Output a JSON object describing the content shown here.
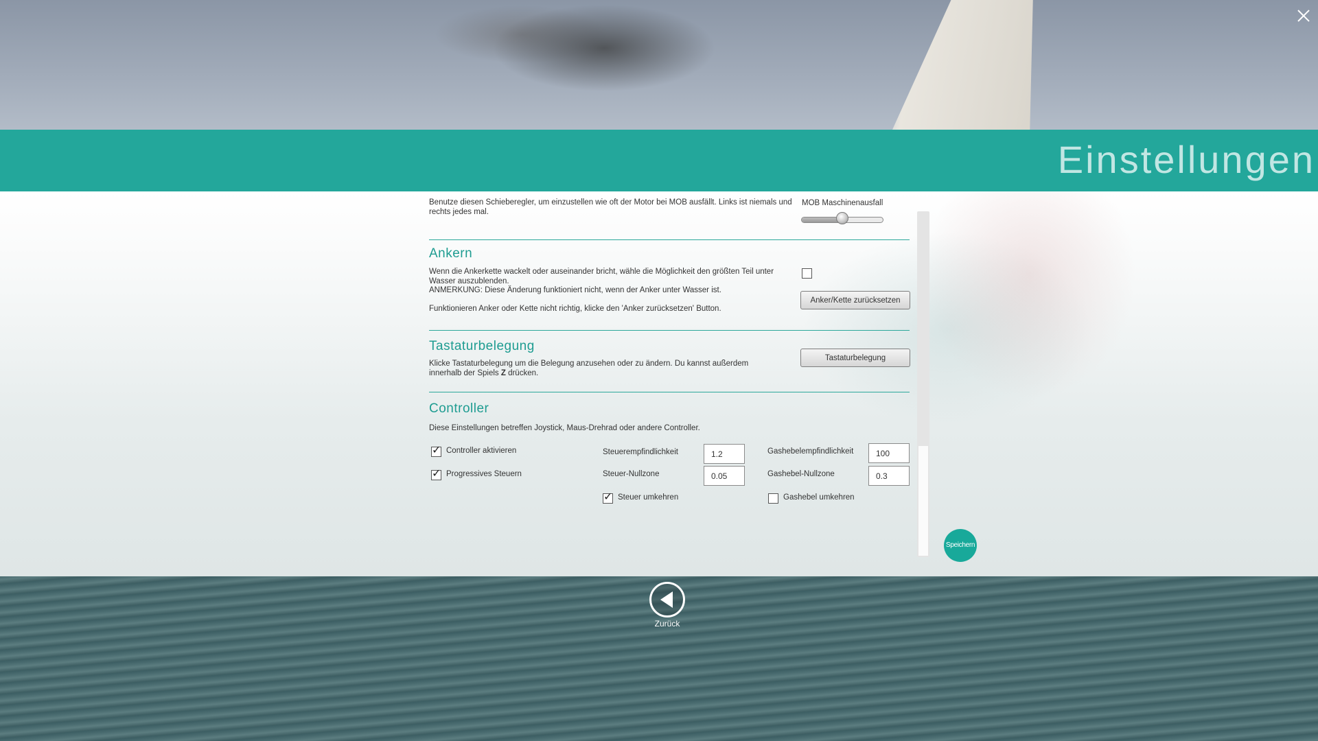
{
  "window": {
    "title": "Einstellungen",
    "close_icon": "close-icon"
  },
  "motor": {
    "description": "Benutze diesen Schieberegler, um einzustellen wie oft der Motor bei MOB ausfällt. Links ist niemals und rechts jedes mal.",
    "slider_label": "MOB Maschinenausfall",
    "slider_value_fraction": 0.5
  },
  "anchor": {
    "title": "Ankern",
    "text_line1": "Wenn die Ankerkette wackelt oder auseinander bricht, wähle die Möglichkeit den größten Teil unter Wasser auszublenden.",
    "text_line2": "ANMERKUNG: Diese Änderung funktioniert nicht, wenn der Anker unter Wasser ist.",
    "text_line3": "Funktionieren Anker oder Kette nicht richtig, klicke den 'Anker zurücksetzen' Button.",
    "hide_checked": false,
    "reset_button": "Anker/Kette zurücksetzen"
  },
  "keyboard": {
    "title": "Tastaturbelegung",
    "text_part1": "Klicke Tastaturbelegung um die Belegung anzusehen oder zu ändern. Du kannst außerdem innerhalb der Spiels ",
    "text_key": "Z",
    "text_part2": " drücken.",
    "button": "Tastaturbelegung"
  },
  "controller": {
    "title": "Controller",
    "description": "Diese Einstellungen betreffen Joystick, Maus-Drehrad oder andere Controller.",
    "enable_label": "Controller aktivieren",
    "enable_checked": true,
    "progressive_label": "Progressives Steuern",
    "progressive_checked": true,
    "steer_sensitivity_label": "Steuerempfindlichkeit",
    "steer_sensitivity_value": "1.2",
    "steer_deadzone_label": "Steuer-Nullzone",
    "steer_deadzone_value": "0.05",
    "steer_invert_label": "Steuer umkehren",
    "steer_invert_checked": true,
    "throttle_sensitivity_label": "Gashebelempfindlichkeit",
    "throttle_sensitivity_value": "100",
    "throttle_deadzone_label": "Gashebel-Nullzone",
    "throttle_deadzone_value": "0.3",
    "throttle_invert_label": "Gashebel umkehren",
    "throttle_invert_checked": false
  },
  "actions": {
    "save": "Speichern",
    "back": "Zurück",
    "back_icon": "back-arrow-icon"
  },
  "colors": {
    "accent": "#23a79b",
    "save_button": "#18a99a"
  }
}
